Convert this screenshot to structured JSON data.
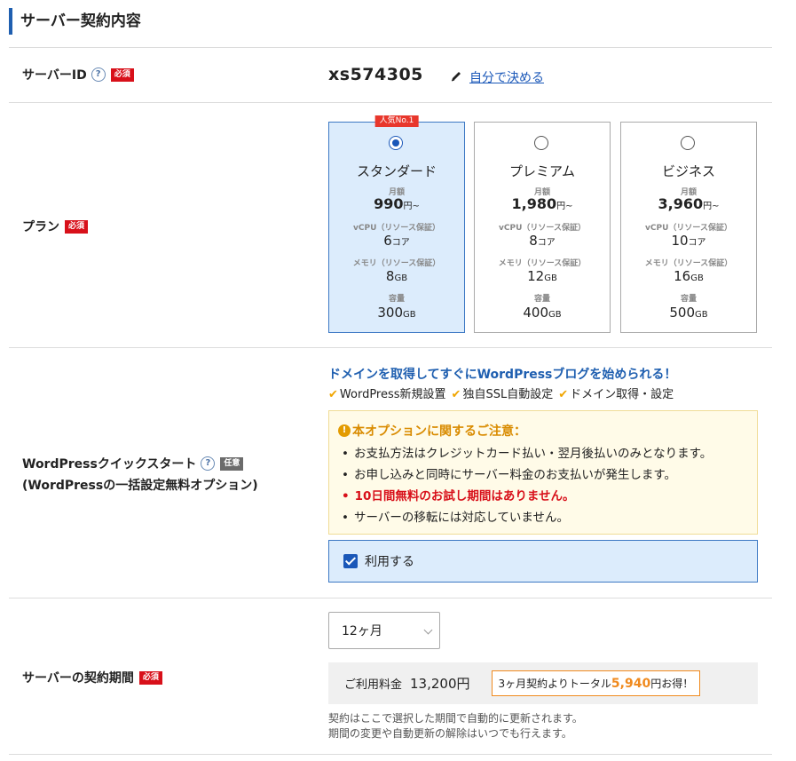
{
  "section_title": "サーバー契約内容",
  "server_id": {
    "label": "サーバーID",
    "required": "必須",
    "value": "xs574305",
    "custom_link": "自分で決める"
  },
  "plan": {
    "label": "プラン",
    "required": "必須",
    "badge": "人気No.1",
    "items": [
      {
        "name": "スタンダード",
        "selected": true,
        "price_label": "月額",
        "price": "990",
        "price_unit": "円~",
        "cpu_label": "vCPU（リソース保証）",
        "cpu": "6",
        "cpu_unit": "コア",
        "mem_label": "メモリ（リソース保証）",
        "mem": "8",
        "mem_unit": "GB",
        "disk_label": "容量",
        "disk": "300",
        "disk_unit": "GB"
      },
      {
        "name": "プレミアム",
        "selected": false,
        "price_label": "月額",
        "price": "1,980",
        "price_unit": "円~",
        "cpu_label": "vCPU（リソース保証）",
        "cpu": "8",
        "cpu_unit": "コア",
        "mem_label": "メモリ（リソース保証）",
        "mem": "12",
        "mem_unit": "GB",
        "disk_label": "容量",
        "disk": "400",
        "disk_unit": "GB"
      },
      {
        "name": "ビジネス",
        "selected": false,
        "price_label": "月額",
        "price": "3,960",
        "price_unit": "円~",
        "cpu_label": "vCPU（リソース保証）",
        "cpu": "10",
        "cpu_unit": "コア",
        "mem_label": "メモリ（リソース保証）",
        "mem": "16",
        "mem_unit": "GB",
        "disk_label": "容量",
        "disk": "500",
        "disk_unit": "GB"
      }
    ]
  },
  "wordpress": {
    "label": "WordPressクイックスタート",
    "optional": "任意",
    "sublabel": "(WordPressの一括設定無料オプション)",
    "headline": "ドメインを取得してすぐにWordPressブログを始められる！",
    "features": [
      "WordPress新規設置",
      "独自SSL自動設定",
      "ドメイン取得・設定"
    ],
    "notice_title": "本オプションに関するご注意：",
    "notices": [
      {
        "text": "お支払方法はクレジットカード払い・翌月後払いのみとなります。",
        "emphasis": false
      },
      {
        "text": "お申し込みと同時にサーバー料金のお支払いが発生します。",
        "emphasis": false
      },
      {
        "text": "10日間無料のお試し期間はありません。",
        "emphasis": true
      },
      {
        "text": "サーバーの移転には対応していません。",
        "emphasis": false
      }
    ],
    "use_label": "利用する",
    "use_checked": true
  },
  "term": {
    "label": "サーバーの契約期間",
    "required": "必須",
    "selected": "12ヶ月",
    "fee_label": "ご利用料金",
    "fee_value": "13,200円",
    "promo_prefix": "3ヶ月契約よりトータル",
    "promo_amount": "5,940",
    "promo_suffix": "円お得！",
    "note_line1": "契約はここで選択した期間で自動的に更新されます。",
    "note_line2": "期間の変更や自動更新の解除はいつでも行えます。"
  },
  "colors": {
    "accent": "#1a57b8",
    "required": "#d8101a",
    "warning": "#d98b00",
    "promo": "#f08a1e"
  }
}
